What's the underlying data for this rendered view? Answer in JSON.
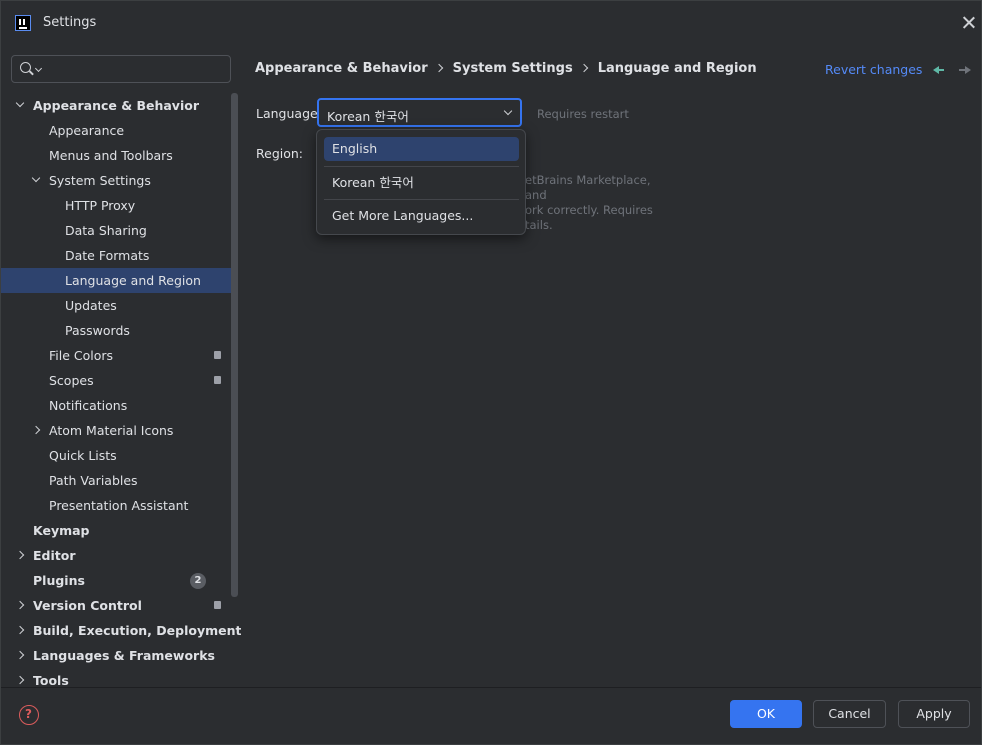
{
  "window": {
    "title": "Settings"
  },
  "search": {
    "placeholder": ""
  },
  "tree": [
    {
      "label": "Appearance & Behavior",
      "expanded": true,
      "bold": true,
      "selected": false
    },
    {
      "label": "Appearance"
    },
    {
      "label": "Menus and Toolbars"
    },
    {
      "label": "System Settings",
      "expanded": true
    },
    {
      "label": "HTTP Proxy"
    },
    {
      "label": "Data Sharing"
    },
    {
      "label": "Date Formats"
    },
    {
      "label": "Language and Region",
      "selected": true
    },
    {
      "label": "Updates"
    },
    {
      "label": "Passwords"
    },
    {
      "label": "File Colors",
      "icon": "project-level-icon"
    },
    {
      "label": "Scopes",
      "icon": "project-level-icon"
    },
    {
      "label": "Notifications"
    },
    {
      "label": "Atom Material Icons",
      "expanded": false
    },
    {
      "label": "Quick Lists"
    },
    {
      "label": "Path Variables"
    },
    {
      "label": "Presentation Assistant"
    },
    {
      "label": "Keymap",
      "bold": true
    },
    {
      "label": "Editor",
      "bold": true,
      "expanded": false
    },
    {
      "label": "Plugins",
      "bold": true,
      "badge": "2"
    },
    {
      "label": "Version Control",
      "bold": true,
      "expanded": false,
      "icon": "project-level-icon"
    },
    {
      "label": "Build, Execution, Deployment",
      "bold": true,
      "expanded": false
    },
    {
      "label": "Languages & Frameworks",
      "bold": true,
      "expanded": false
    },
    {
      "label": "Tools",
      "bold": true,
      "expanded": false
    }
  ],
  "breadcrumb": [
    "Appearance & Behavior",
    "System Settings",
    "Language and Region"
  ],
  "header": {
    "revert_label": "Revert changes"
  },
  "form": {
    "language_label": "Language:",
    "language_value": "Korean 한국어",
    "restart_note": "Requires restart",
    "region_label": "Region:",
    "help_lines": [
      "etBrains Marketplace, and",
      "ork correctly. Requires",
      "tails."
    ]
  },
  "dropdown": {
    "options": [
      "English",
      "Korean 한국어",
      "Get More Languages..."
    ],
    "highlighted": "English"
  },
  "footer": {
    "help_symbol": "?",
    "ok_label": "OK",
    "cancel_label": "Cancel",
    "apply_label": "Apply"
  },
  "colors": {
    "accent": "#3574f0",
    "selection": "#2e436e",
    "link": "#548af7",
    "background": "#2b2d30"
  }
}
